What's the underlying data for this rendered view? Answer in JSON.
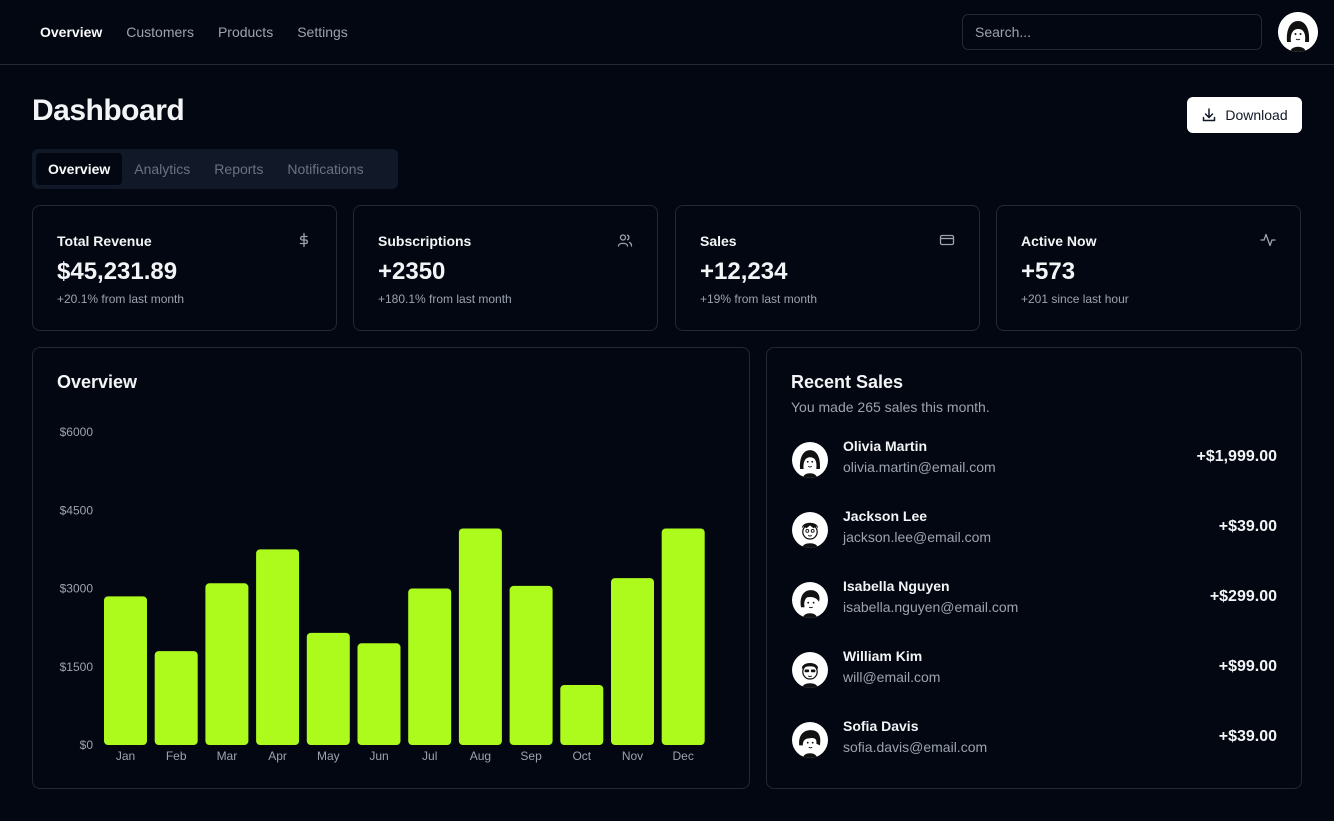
{
  "nav": {
    "links": [
      "Overview",
      "Customers",
      "Products",
      "Settings"
    ],
    "active": "Overview",
    "search_placeholder": "Search..."
  },
  "page": {
    "title": "Dashboard",
    "download_label": "Download",
    "tabs": [
      "Overview",
      "Analytics",
      "Reports",
      "Notifications"
    ],
    "active_tab": "Overview"
  },
  "stats": [
    {
      "title": "Total Revenue",
      "value": "$45,231.89",
      "sub": "+20.1% from last month",
      "icon": "dollar-icon"
    },
    {
      "title": "Subscriptions",
      "value": "+2350",
      "sub": "+180.1% from last month",
      "icon": "users-icon"
    },
    {
      "title": "Sales",
      "value": "+12,234",
      "sub": "+19% from last month",
      "icon": "credit-card-icon"
    },
    {
      "title": "Active Now",
      "value": "+573",
      "sub": "+201 since last hour",
      "icon": "activity-icon"
    }
  ],
  "overview": {
    "title": "Overview"
  },
  "chart_data": {
    "type": "bar",
    "title": "",
    "categories": [
      "Jan",
      "Feb",
      "Mar",
      "Apr",
      "May",
      "Jun",
      "Jul",
      "Aug",
      "Sep",
      "Oct",
      "Nov",
      "Dec"
    ],
    "values": [
      2850,
      1800,
      3100,
      3750,
      2150,
      1950,
      3000,
      4150,
      3050,
      1150,
      3200,
      4150
    ],
    "y_ticks": [
      "$0",
      "$1500",
      "$3000",
      "$4500",
      "$6000"
    ],
    "ylim": [
      0,
      6000
    ],
    "bar_color": "#adfa1d",
    "grid": false,
    "legend": "none"
  },
  "recent_sales": {
    "title": "Recent Sales",
    "subtitle": "You made 265 sales this month.",
    "items": [
      {
        "name": "Olivia Martin",
        "email": "olivia.martin@email.com",
        "amount": "+$1,999.00"
      },
      {
        "name": "Jackson Lee",
        "email": "jackson.lee@email.com",
        "amount": "+$39.00"
      },
      {
        "name": "Isabella Nguyen",
        "email": "isabella.nguyen@email.com",
        "amount": "+$299.00"
      },
      {
        "name": "William Kim",
        "email": "will@email.com",
        "amount": "+$99.00"
      },
      {
        "name": "Sofia Davis",
        "email": "sofia.davis@email.com",
        "amount": "+$39.00"
      }
    ]
  },
  "colors": {
    "background": "#030712",
    "border": "#1f2937",
    "accent": "#adfa1d",
    "muted_text": "#9ca3af"
  }
}
